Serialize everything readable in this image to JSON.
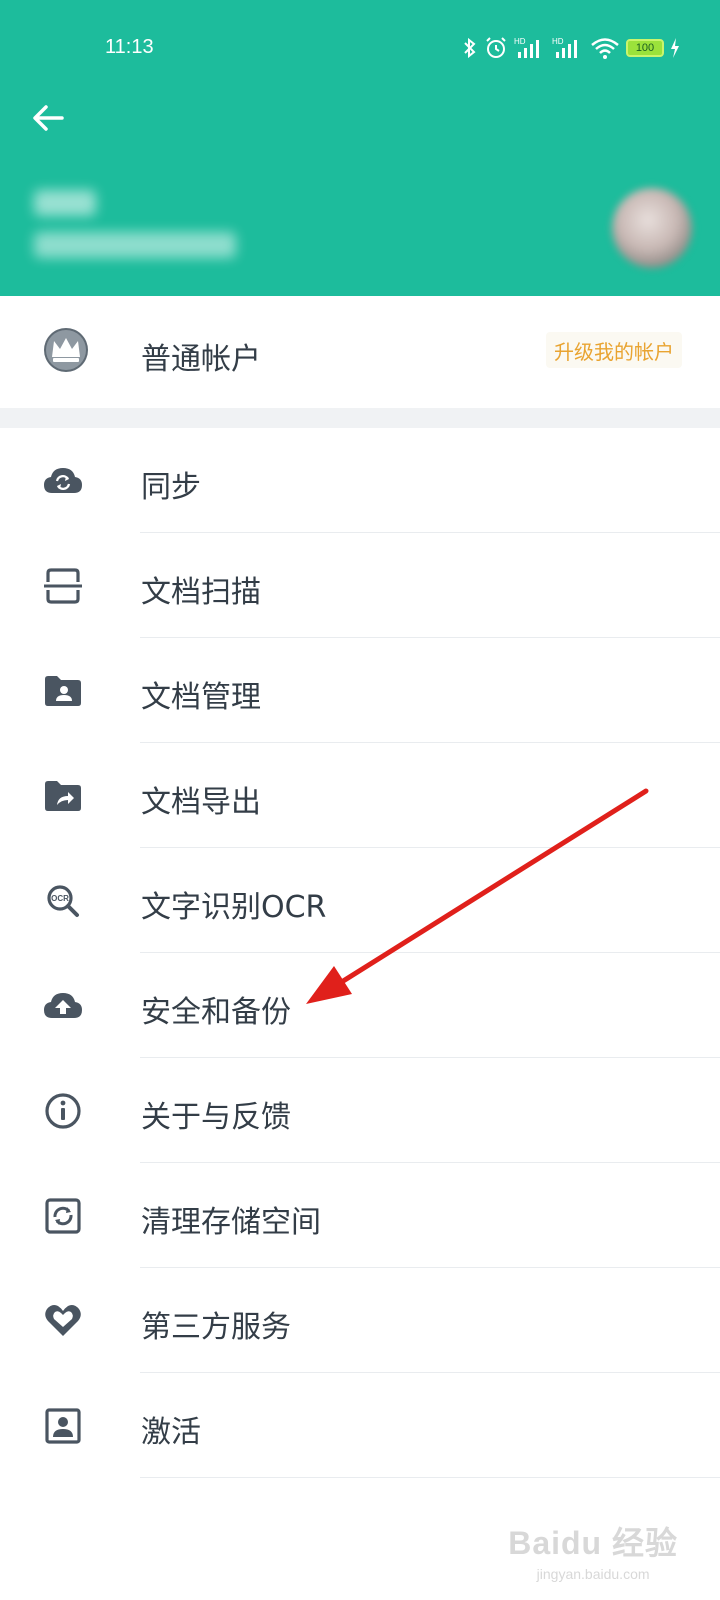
{
  "status_bar": {
    "time": "11:13",
    "battery": "100"
  },
  "header": {
    "back_icon": "arrow-left-icon"
  },
  "account": {
    "label": "普通帐户",
    "upgrade_label": "升级我的帐户",
    "icon": "crown-icon"
  },
  "menu": {
    "items": [
      {
        "label": "同步",
        "icon": "cloud-sync-icon"
      },
      {
        "label": "文档扫描",
        "icon": "scan-icon"
      },
      {
        "label": "文档管理",
        "icon": "folder-user-icon"
      },
      {
        "label": "文档导出",
        "icon": "folder-share-icon"
      },
      {
        "label": "文字识别OCR",
        "icon": "ocr-search-icon"
      },
      {
        "label": "安全和备份",
        "icon": "cloud-upload-icon"
      },
      {
        "label": "关于与反馈",
        "icon": "info-icon"
      },
      {
        "label": "清理存储空间",
        "icon": "clean-storage-icon"
      },
      {
        "label": "第三方服务",
        "icon": "heart-icon"
      },
      {
        "label": "激活",
        "icon": "person-card-icon"
      }
    ]
  },
  "watermark": {
    "main": "Baidu 经验",
    "sub": "jingyan.baidu.com"
  },
  "colors": {
    "header": "#1dbc9c",
    "upgrade_text": "#e9a431",
    "menu_text": "#333d47",
    "icon": "#4a5561",
    "annotation": "#e0201b"
  }
}
